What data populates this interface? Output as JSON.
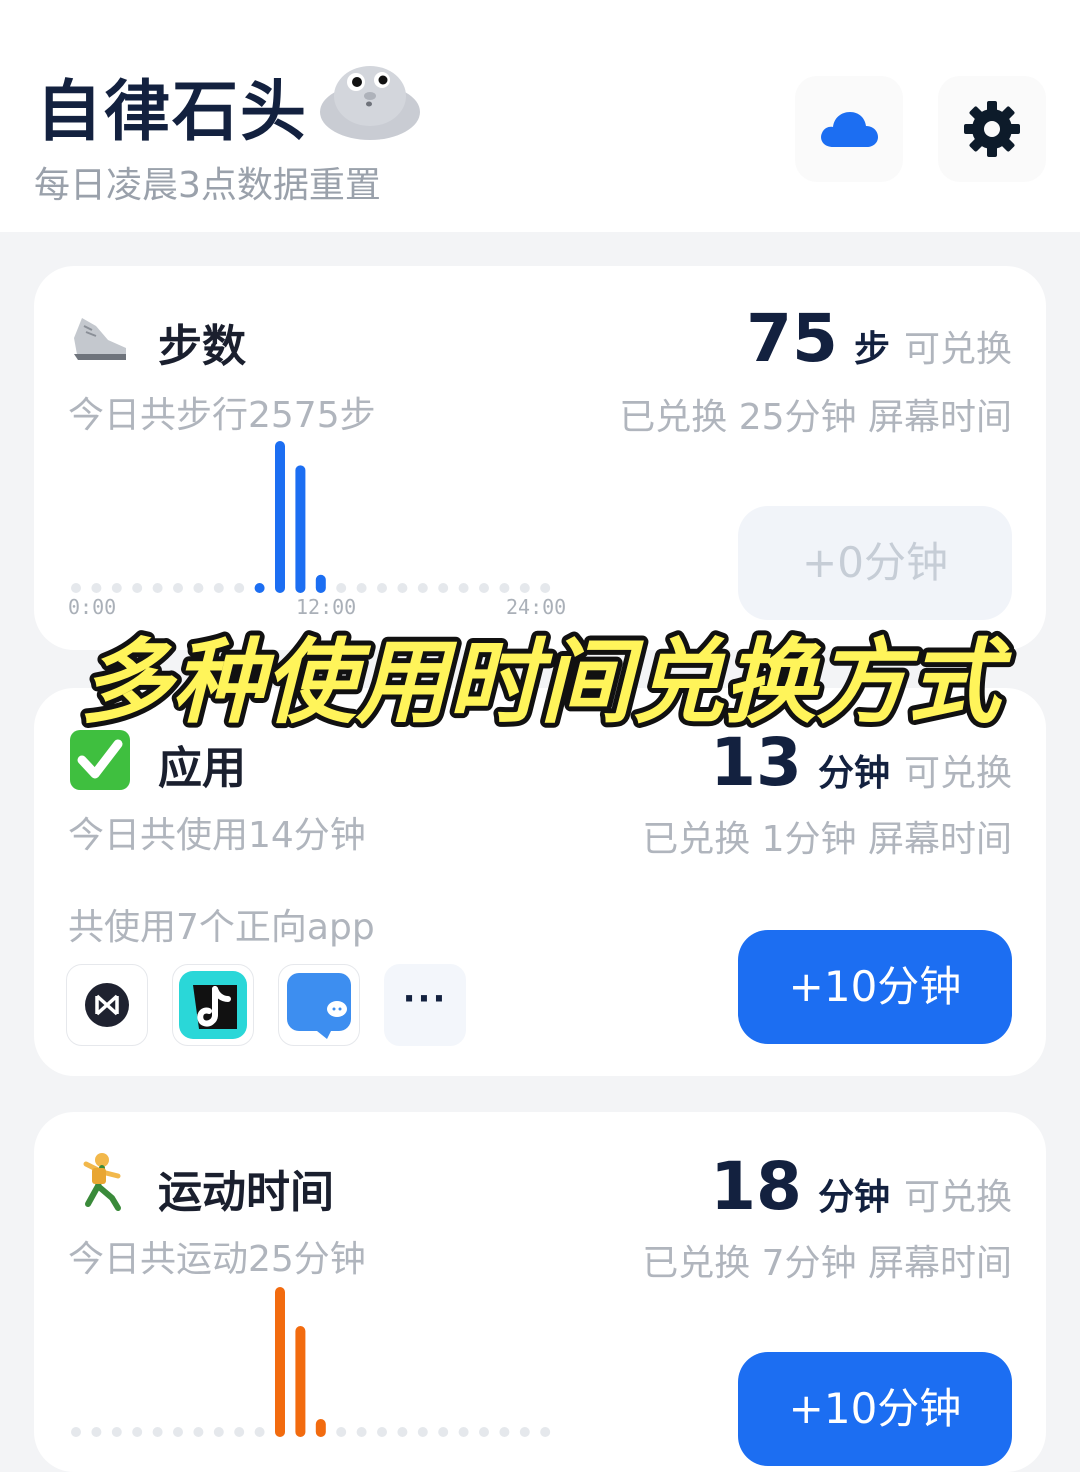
{
  "header": {
    "title": "自律石头",
    "subtitle": "每日凌晨3点数据重置"
  },
  "steps_card": {
    "title": "步数",
    "subtitle": "今日共步行2575步",
    "big_number": "75",
    "big_unit": "步",
    "big_tail": "可兑换",
    "exchanged_line": "已兑换 25分钟 屏幕时间",
    "button_label": "+0分钟",
    "chart_data": {
      "type": "bar",
      "x_ticks": [
        "0:00",
        "12:00",
        "24:00"
      ],
      "bars": [
        {
          "hour": 9,
          "value": 6
        },
        {
          "hour": 10,
          "value": 100
        },
        {
          "hour": 11,
          "value": 84
        },
        {
          "hour": 12,
          "value": 12
        }
      ],
      "color": "#1c6ef2"
    }
  },
  "apps_card": {
    "title": "应用",
    "subtitle": "今日共使用14分钟",
    "big_number": "13",
    "big_unit": "分钟",
    "big_tail": "可兑换",
    "exchanged_line": "已兑换 1分钟 屏幕时间",
    "apps_label": "共使用7个正向app",
    "app_icons": [
      "app-logo-icon",
      "tiktok-icon",
      "chat-app-icon",
      "more-icon"
    ],
    "more_label": "···",
    "button_label": "+10分钟"
  },
  "exercise_card": {
    "title": "运动时间",
    "subtitle": "今日共运动25分钟",
    "big_number": "18",
    "big_unit": "分钟",
    "big_tail": "可兑换",
    "exchanged_line": "已兑换 7分钟 屏幕时间",
    "button_label": "+10分钟",
    "chart_data": {
      "type": "bar",
      "bars": [
        {
          "hour": 10,
          "value": 100
        },
        {
          "hour": 11,
          "value": 74
        },
        {
          "hour": 12,
          "value": 12
        }
      ],
      "color": "#f26b0f"
    }
  },
  "banner": {
    "text": "多种使用时间兑换方式"
  }
}
